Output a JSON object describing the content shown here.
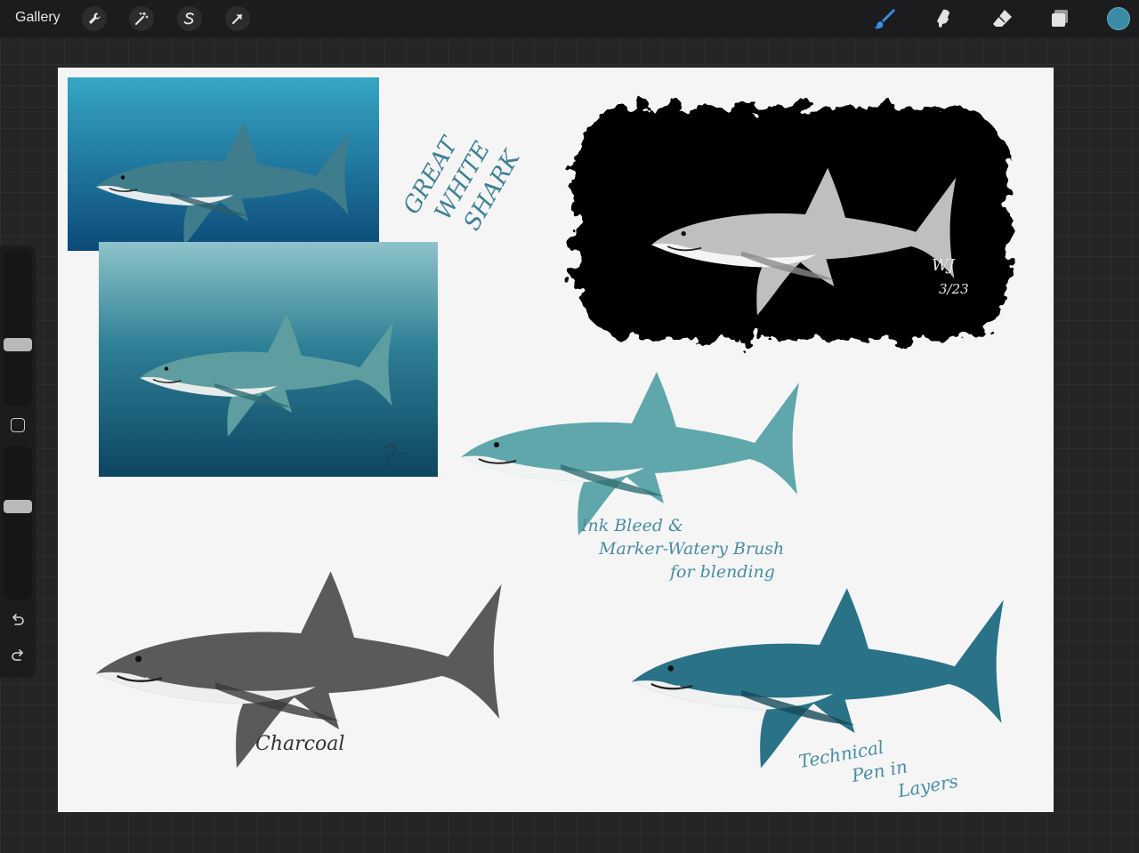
{
  "topbar": {
    "gallery_label": "Gallery",
    "actions_icon": "wrench-icon",
    "adjustments_icon": "magic-wand-icon",
    "selection_icon": "selection-s-icon",
    "transform_icon": "arrow-cursor-icon",
    "tools": [
      "brush-icon",
      "smudge-icon",
      "eraser-icon",
      "layers-icon"
    ],
    "current_color": "#3b8aa8",
    "active_tool_color": "#3a8ee6"
  },
  "sidebar": {
    "brush_size_level": 0.38,
    "opacity_level": 0.62,
    "modify_icon": "square-icon",
    "undo_icon": "undo-icon",
    "redo_icon": "redo-icon"
  },
  "canvas": {
    "heading_lines": [
      "GREAT",
      "WHITE",
      "SHARK"
    ],
    "signature_initials": "WJ",
    "signature_date": "3/23",
    "note_ink_lines": [
      "Ink Bleed &",
      "Marker-Watery Brush",
      "for blending"
    ],
    "note_charcoal": "Charcoal",
    "note_technical_lines": [
      "Technical",
      "Pen in",
      "Layers"
    ],
    "ink_color": "#3f7f95"
  }
}
